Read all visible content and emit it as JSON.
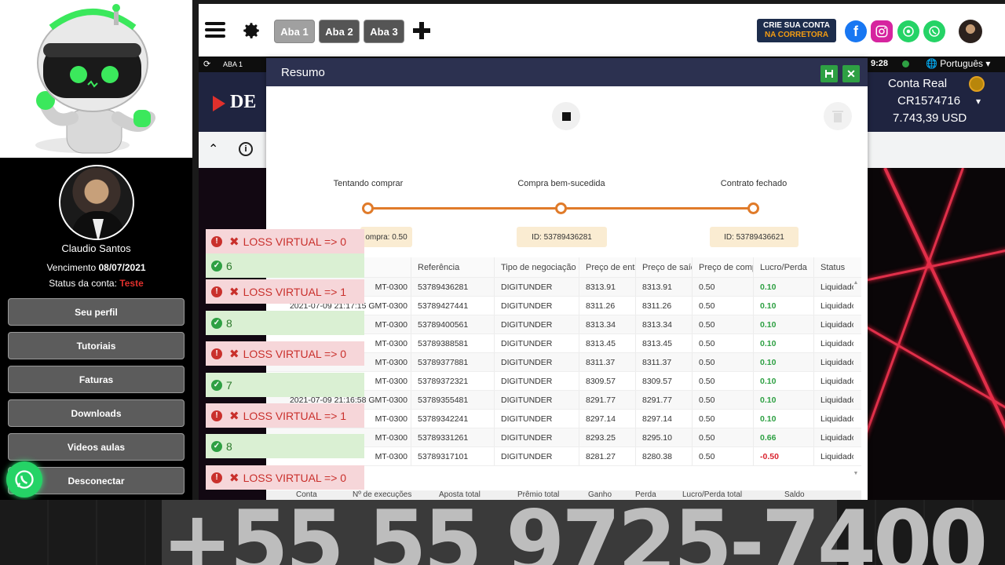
{
  "sidebar": {
    "user_name": "Claudio Santos",
    "expiry_label": "Vencimento",
    "expiry_date": "08/07/2021",
    "status_label": "Status da conta:",
    "status_value": "Teste",
    "buttons": [
      "Seu perfil",
      "Tutoriais",
      "Faturas",
      "Downloads",
      "Videos aulas",
      "Desconectar"
    ]
  },
  "topbar": {
    "tabs": [
      "Aba 1",
      "Aba 2",
      "Aba 3"
    ],
    "active_tab": "Aba 1",
    "crie_line1": "CRIE SUA CONTA",
    "crie_line2": "NA CORRETORA"
  },
  "platform": {
    "tab_label": "ABA 1",
    "logo_text": "DE",
    "clock": "9:28",
    "language": "Português",
    "account_type": "Conta Real",
    "account_id": "CR1574716",
    "balance": "7.743,39 USD"
  },
  "modal": {
    "title": "Resumo",
    "steps": [
      "Tentando comprar",
      "Compra bem-sucedida",
      "Contrato fechado"
    ],
    "chips": [
      "ompra: 0.50",
      "ID: 53789436281",
      "ID: 53789436621"
    ],
    "columns": [
      "",
      "Referência",
      "Tipo de negociação",
      "Preço de entrada",
      "Preço de saída",
      "Preço de compra",
      "Lucro/Perda",
      "Status"
    ],
    "rows": [
      {
        "time": "MT-0300",
        "ref": "53789436281",
        "type": "DIGITUNDER",
        "entry": "8313.91",
        "exit": "8313.91",
        "buy": "0.50",
        "pl": "0.10",
        "status": "Liquidado"
      },
      {
        "time": "2021-07-09 21:17:15 GMT-0300",
        "ref": "53789427441",
        "type": "DIGITUNDER",
        "entry": "8311.26",
        "exit": "8311.26",
        "buy": "0.50",
        "pl": "0.10",
        "status": "Liquidado"
      },
      {
        "time": "MT-0300",
        "ref": "53789400561",
        "type": "DIGITUNDER",
        "entry": "8313.34",
        "exit": "8313.34",
        "buy": "0.50",
        "pl": "0.10",
        "status": "Liquidado"
      },
      {
        "time": "MT-0300",
        "ref": "53789388581",
        "type": "DIGITUNDER",
        "entry": "8313.45",
        "exit": "8313.45",
        "buy": "0.50",
        "pl": "0.10",
        "status": "Liquidado"
      },
      {
        "time": "MT-0300",
        "ref": "53789377881",
        "type": "DIGITUNDER",
        "entry": "8311.37",
        "exit": "8311.37",
        "buy": "0.50",
        "pl": "0.10",
        "status": "Liquidado"
      },
      {
        "time": "MT-0300",
        "ref": "53789372321",
        "type": "DIGITUNDER",
        "entry": "8309.57",
        "exit": "8309.57",
        "buy": "0.50",
        "pl": "0.10",
        "status": "Liquidado"
      },
      {
        "time": "2021-07-09 21:16:58 GMT-0300",
        "ref": "53789355481",
        "type": "DIGITUNDER",
        "entry": "8291.77",
        "exit": "8291.77",
        "buy": "0.50",
        "pl": "0.10",
        "status": "Liquidado"
      },
      {
        "time": "MT-0300",
        "ref": "53789342241",
        "type": "DIGITUNDER",
        "entry": "8297.14",
        "exit": "8297.14",
        "buy": "0.50",
        "pl": "0.10",
        "status": "Liquidado"
      },
      {
        "time": "MT-0300",
        "ref": "53789331261",
        "type": "DIGITUNDER",
        "entry": "8293.25",
        "exit": "8295.10",
        "buy": "0.50",
        "pl": "0.66",
        "status": "Liquidado"
      },
      {
        "time": "MT-0300",
        "ref": "53789317101",
        "type": "DIGITUNDER",
        "entry": "8281.27",
        "exit": "8280.38",
        "buy": "0.50",
        "pl": "-0.50",
        "status": "Liquidado"
      }
    ],
    "summary_columns": [
      "Conta",
      "Nº de execuções",
      "Aposta total",
      "Prêmio total",
      "Ganho",
      "Perda",
      "Lucro/Perda total",
      "Saldo"
    ]
  },
  "notifications": [
    {
      "kind": "loss",
      "text": "LOSS VIRTUAL => 0"
    },
    {
      "kind": "win",
      "text": "6"
    },
    {
      "kind": "loss",
      "text": "LOSS VIRTUAL => 1"
    },
    {
      "kind": "win",
      "text": "8"
    },
    {
      "kind": "loss",
      "text": "LOSS VIRTUAL => 0"
    },
    {
      "kind": "win",
      "text": "7"
    },
    {
      "kind": "loss",
      "text": "LOSS VIRTUAL => 1"
    },
    {
      "kind": "win",
      "text": "8"
    },
    {
      "kind": "loss",
      "text": "LOSS VIRTUAL => 0"
    }
  ],
  "banner": {
    "phone": "+55 55 9725-7400"
  },
  "colors": {
    "accent_orange": "#e07b2a",
    "profit_green": "#2ea043",
    "loss_red": "#d9232e",
    "modal_header": "#2c3150"
  }
}
